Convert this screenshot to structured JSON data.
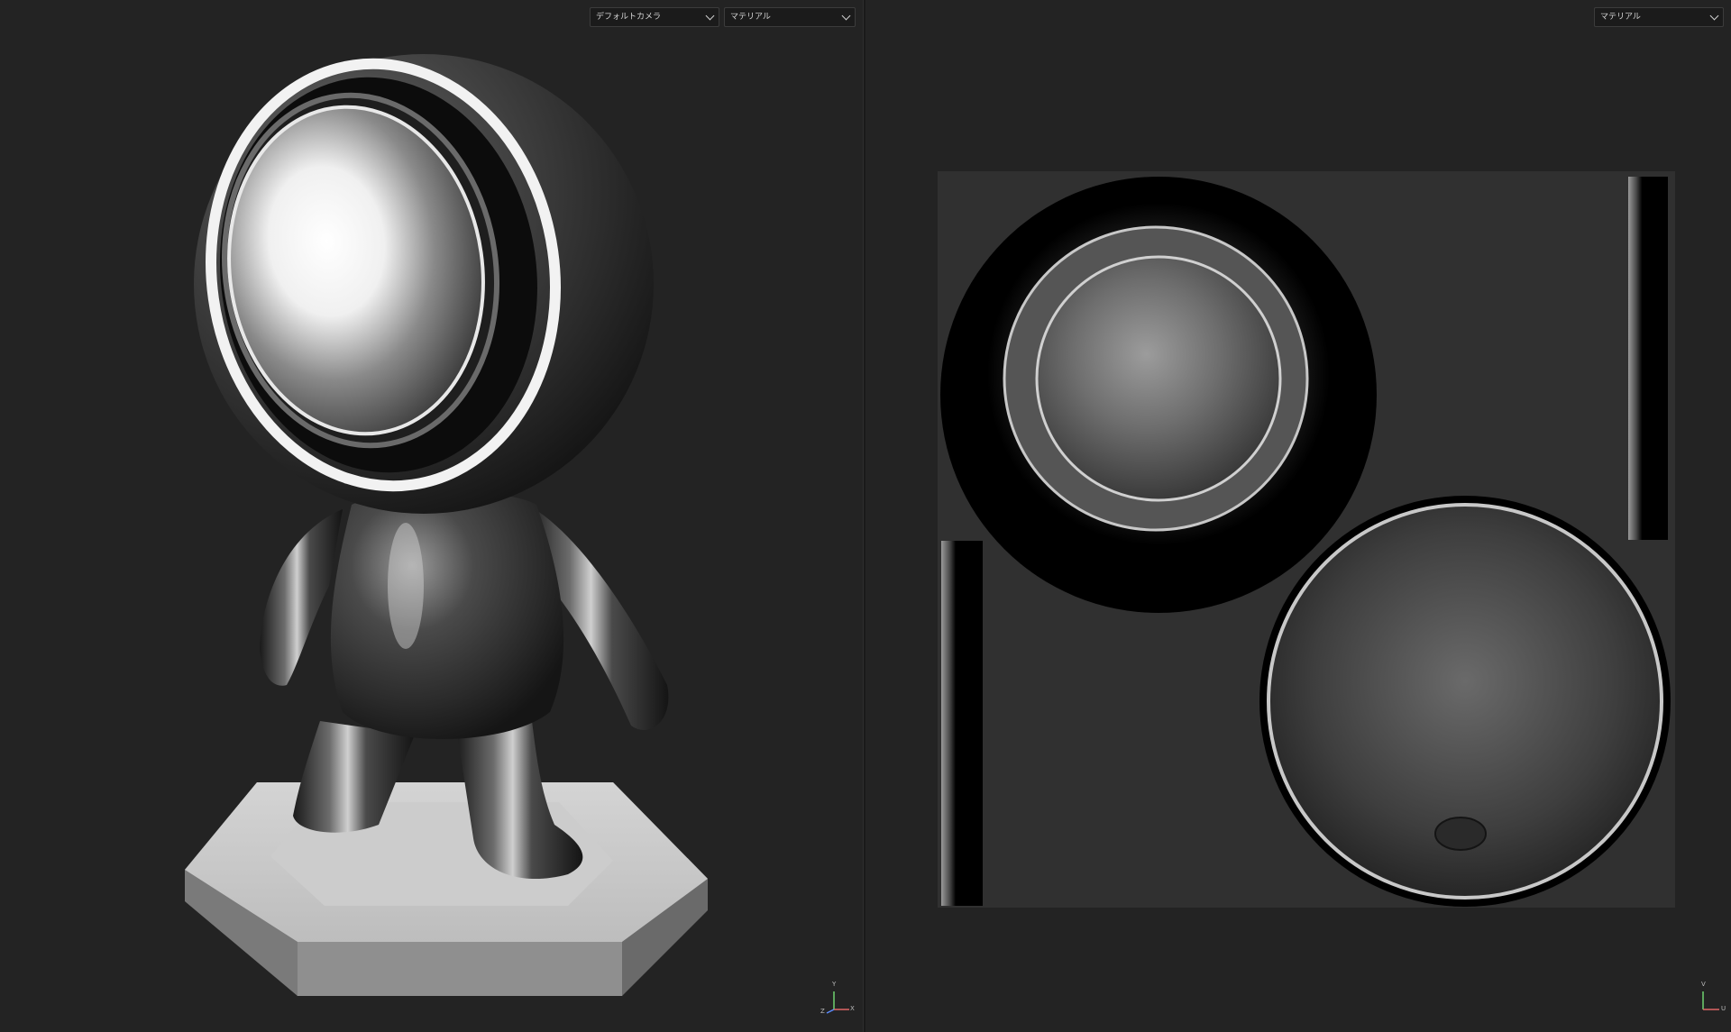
{
  "viewport_3d": {
    "camera_dropdown": "デフォルトカメラ",
    "material_dropdown": "マテリアル",
    "gizmo": {
      "y": "Y",
      "x": "X",
      "z": "Z"
    }
  },
  "viewport_uv": {
    "material_dropdown": "マテリアル",
    "gizmo": {
      "v": "V",
      "u": "U"
    }
  },
  "colors": {
    "viewport_bg": "#232323",
    "uv_canvas": "#303030",
    "axis_y": "#6fd36f",
    "axis_x": "#e06666",
    "axis_z": "#5c8cff"
  }
}
